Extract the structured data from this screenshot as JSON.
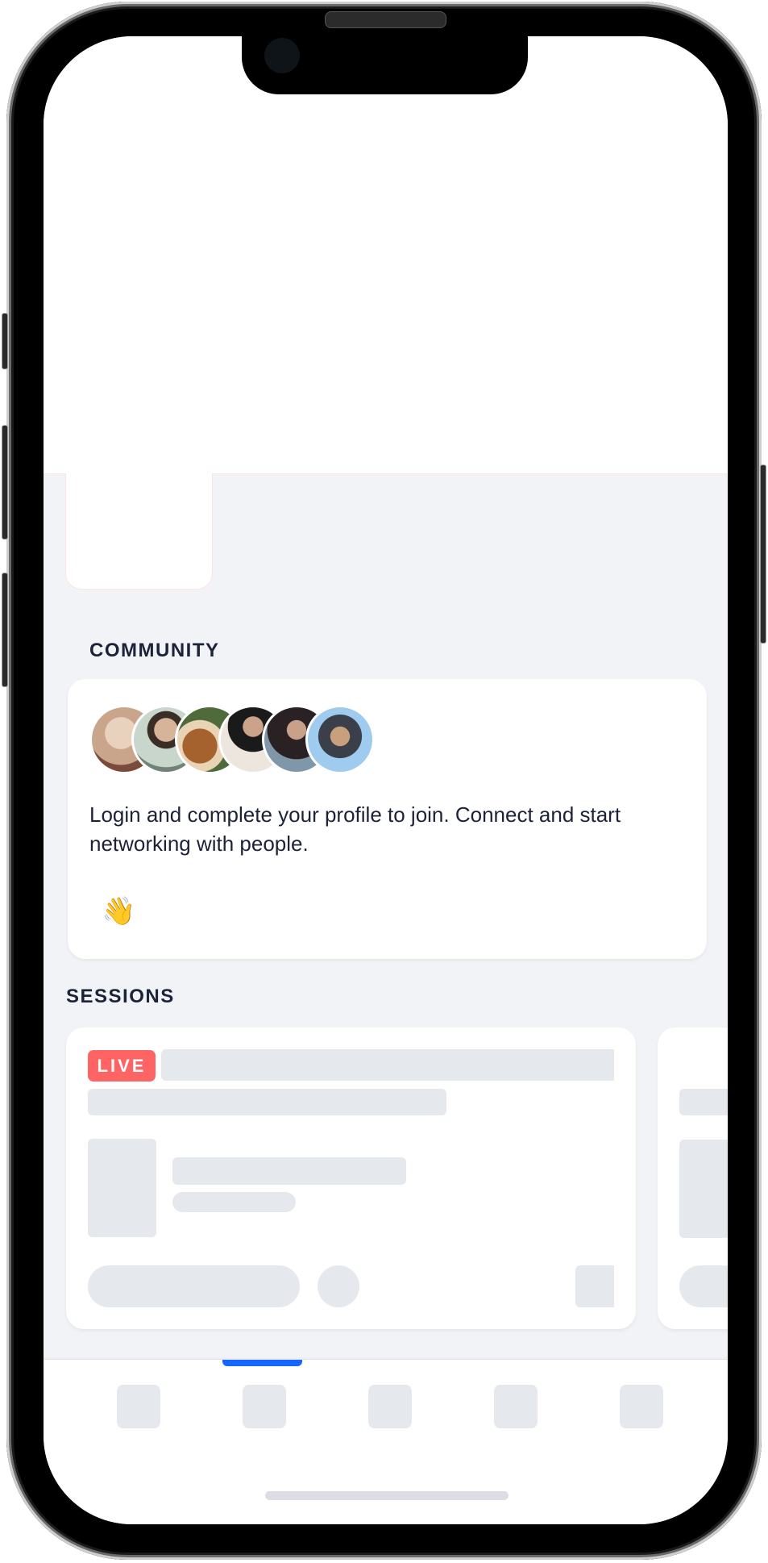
{
  "community": {
    "title": "COMMUNITY",
    "avatars": [
      {
        "name": "avatar-1",
        "color": "#c9a58c"
      },
      {
        "name": "avatar-2",
        "color": "#8fa39a"
      },
      {
        "name": "avatar-3",
        "color": "#9b6a3f"
      },
      {
        "name": "avatar-4",
        "color": "#b9b0a6"
      },
      {
        "name": "avatar-5",
        "color": "#3b3f4a"
      },
      {
        "name": "avatar-6",
        "color": "#8cbbe6"
      }
    ],
    "message": "Login and complete your profile to join. Connect and start networking with people.",
    "wave_emoji": "👋"
  },
  "sessions": {
    "title": "SESSIONS",
    "cards": [
      {
        "badge": "LIVE"
      }
    ]
  },
  "colors": {
    "live_badge": "#ff6464",
    "accent": "#1565ff",
    "text": "#1c2238",
    "background": "#f2f3f7",
    "skeleton": "#e5e8ed"
  },
  "tabbar": {
    "active_index": 1,
    "tab_count": 5
  }
}
